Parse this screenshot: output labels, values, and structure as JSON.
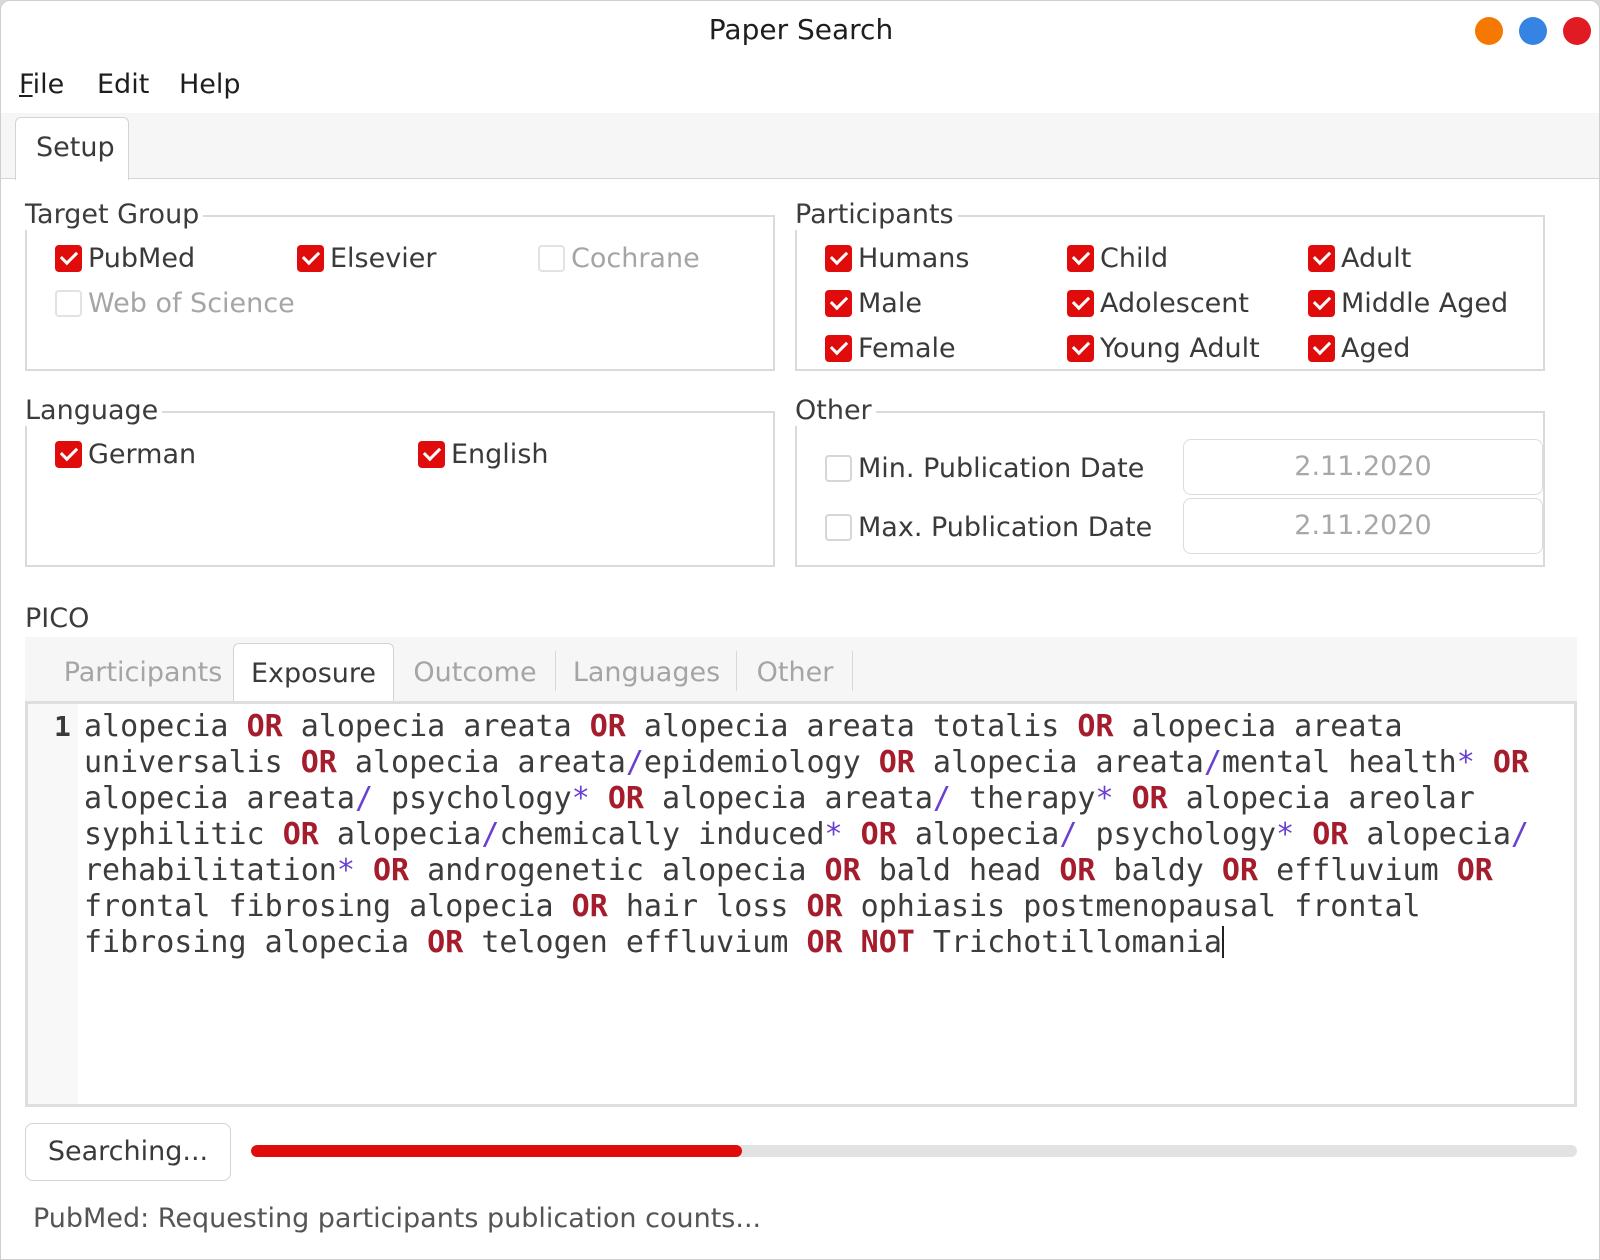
{
  "window": {
    "title": "Paper Search",
    "controls": [
      {
        "name": "minimize",
        "color": "#f57900"
      },
      {
        "name": "maximize",
        "color": "#3584e4"
      },
      {
        "name": "close",
        "color": "#e01b24"
      }
    ]
  },
  "menu": {
    "file_mnemonic": "F",
    "file_rest": "ile",
    "edit": "Edit",
    "help": "Help"
  },
  "tabs": {
    "setup": "Setup"
  },
  "target_group": {
    "title": "Target Group",
    "items": [
      {
        "label": "PubMed",
        "checked": true,
        "enabled": true
      },
      {
        "label": "Elsevier",
        "checked": true,
        "enabled": true
      },
      {
        "label": "Cochrane",
        "checked": false,
        "enabled": false
      },
      {
        "label": "Web of Science",
        "checked": false,
        "enabled": false
      }
    ]
  },
  "participants": {
    "title": "Participants",
    "items": [
      {
        "label": "Humans",
        "checked": true
      },
      {
        "label": "Child",
        "checked": true
      },
      {
        "label": "Adult",
        "checked": true
      },
      {
        "label": "Male",
        "checked": true
      },
      {
        "label": "Adolescent",
        "checked": true
      },
      {
        "label": "Middle Aged",
        "checked": true
      },
      {
        "label": "Female",
        "checked": true
      },
      {
        "label": "Young Adult",
        "checked": true
      },
      {
        "label": "Aged",
        "checked": true
      }
    ]
  },
  "language": {
    "title": "Language",
    "items": [
      {
        "label": "German",
        "checked": true
      },
      {
        "label": "English",
        "checked": true
      }
    ]
  },
  "other": {
    "title": "Other",
    "min_date_label": "Min. Publication Date",
    "min_date_checked": false,
    "min_date_value": "2.11.2020",
    "max_date_label": "Max. Publication Date",
    "max_date_checked": false,
    "max_date_value": "2.11.2020"
  },
  "pico": {
    "title": "PICO",
    "tabs": [
      "Participants",
      "Exposure",
      "Outcome",
      "Languages",
      "Other"
    ],
    "active_tab": "Exposure",
    "line_number": "1",
    "query_tokens": [
      [
        "t",
        "alopecia "
      ],
      [
        "k",
        "OR"
      ],
      [
        "t",
        " alopecia areata "
      ],
      [
        "k",
        "OR"
      ],
      [
        "t",
        " alopecia areata totalis "
      ],
      [
        "k",
        "OR"
      ],
      [
        "t",
        " alopecia areata universalis "
      ],
      [
        "k",
        "OR"
      ],
      [
        "t",
        " alopecia areata"
      ],
      [
        "o",
        "/"
      ],
      [
        "t",
        "epidemiology "
      ],
      [
        "k",
        "OR"
      ],
      [
        "t",
        " alopecia areata"
      ],
      [
        "o",
        "/"
      ],
      [
        "t",
        "mental health"
      ],
      [
        "o",
        "*"
      ],
      [
        "t",
        " "
      ],
      [
        "k",
        "OR"
      ],
      [
        "t",
        " alopecia areata"
      ],
      [
        "o",
        "/"
      ],
      [
        "t",
        " psychology"
      ],
      [
        "o",
        "*"
      ],
      [
        "t",
        " "
      ],
      [
        "k",
        "OR"
      ],
      [
        "t",
        " alopecia areata"
      ],
      [
        "o",
        "/"
      ],
      [
        "t",
        " therapy"
      ],
      [
        "o",
        "*"
      ],
      [
        "t",
        " "
      ],
      [
        "k",
        "OR"
      ],
      [
        "t",
        " alopecia areolar syphilitic "
      ],
      [
        "k",
        "OR"
      ],
      [
        "t",
        " alopecia"
      ],
      [
        "o",
        "/"
      ],
      [
        "t",
        "chemically induced"
      ],
      [
        "o",
        "*"
      ],
      [
        "t",
        " "
      ],
      [
        "k",
        "OR"
      ],
      [
        "t",
        " alopecia"
      ],
      [
        "o",
        "/"
      ],
      [
        "t",
        " psychology"
      ],
      [
        "o",
        "*"
      ],
      [
        "t",
        " "
      ],
      [
        "k",
        "OR"
      ],
      [
        "t",
        " alopecia"
      ],
      [
        "o",
        "/"
      ],
      [
        "t",
        " rehabilitation"
      ],
      [
        "o",
        "*"
      ],
      [
        "t",
        " "
      ],
      [
        "k",
        "OR"
      ],
      [
        "t",
        " androgenetic alopecia "
      ],
      [
        "k",
        "OR"
      ],
      [
        "t",
        " bald head "
      ],
      [
        "k",
        "OR"
      ],
      [
        "t",
        " baldy "
      ],
      [
        "k",
        "OR"
      ],
      [
        "t",
        " effluvium "
      ],
      [
        "k",
        "OR"
      ],
      [
        "t",
        " frontal fibrosing alopecia "
      ],
      [
        "k",
        "OR"
      ],
      [
        "t",
        " hair loss "
      ],
      [
        "k",
        "OR"
      ],
      [
        "t",
        " ophiasis postmenopausal frontal fibrosing alopecia "
      ],
      [
        "k",
        "OR"
      ],
      [
        "t",
        " telogen effluvium "
      ],
      [
        "k",
        "OR"
      ],
      [
        "t",
        " "
      ],
      [
        "k",
        "NOT"
      ],
      [
        "t",
        " Trichotillomania"
      ]
    ]
  },
  "footer": {
    "search_button": "Searching...",
    "progress_percent": 37,
    "status": "PubMed: Requesting participants publication counts..."
  },
  "colors": {
    "accent": "#e00c0c",
    "keyword": "#a51d2d",
    "operator": "#6a3fd1"
  }
}
